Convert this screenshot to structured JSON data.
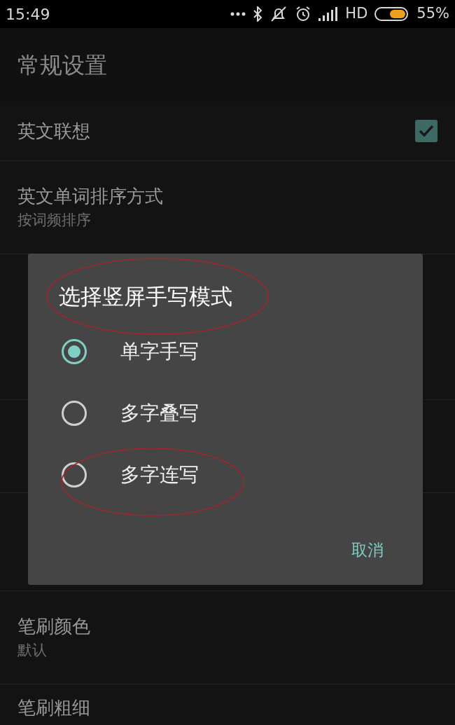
{
  "status_bar": {
    "time": "15:49",
    "network": "HD",
    "battery": "55%"
  },
  "title": "常规设置",
  "rows": [
    {
      "kind": "checkbox",
      "label": "英文联想",
      "checked": true
    },
    {
      "kind": "value",
      "label": "英文单词排序方式",
      "value": "按词频排序"
    },
    {
      "kind": "header"
    },
    {
      "kind": "value"
    },
    {
      "kind": "value"
    },
    {
      "kind": "tall"
    },
    {
      "kind": "value",
      "label": "笔刷颜色",
      "value": "默认"
    },
    {
      "kind": "plain",
      "label": "笔刷粗细"
    }
  ],
  "dialog": {
    "title": "选择竖屏手写模式",
    "title_circled": true,
    "options": [
      {
        "label": "单字手写",
        "selected": true,
        "circled": false
      },
      {
        "label": "多字叠写",
        "selected": false,
        "circled": false
      },
      {
        "label": "多字连写",
        "selected": false,
        "circled": true
      }
    ],
    "cancel": "取消"
  }
}
